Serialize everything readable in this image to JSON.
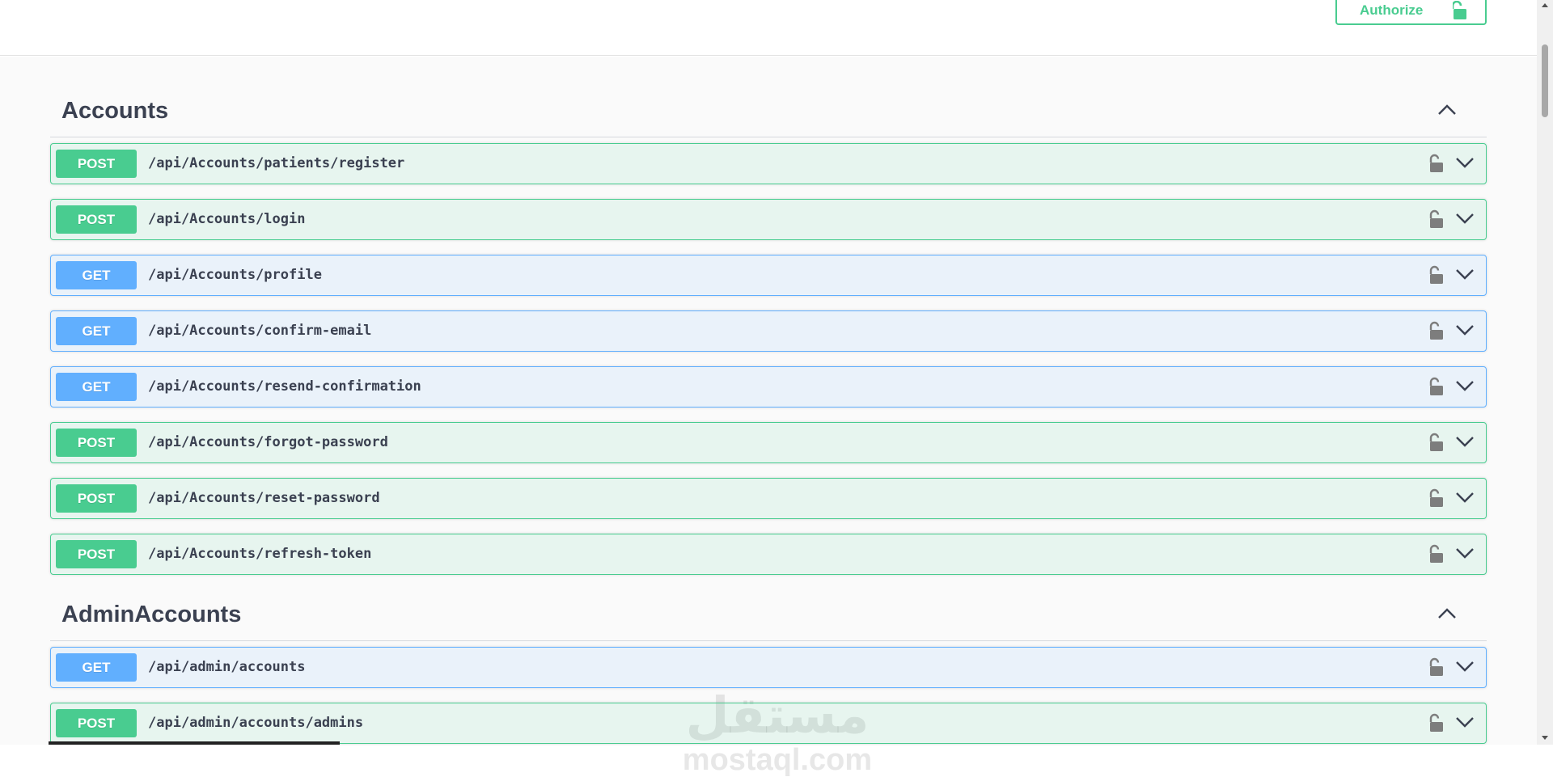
{
  "header": {
    "authorize_label": "Authorize"
  },
  "sections": [
    {
      "title": "Accounts",
      "operations": [
        {
          "method": "POST",
          "path": "/api/Accounts/patients/register"
        },
        {
          "method": "POST",
          "path": "/api/Accounts/login"
        },
        {
          "method": "GET",
          "path": "/api/Accounts/profile"
        },
        {
          "method": "GET",
          "path": "/api/Accounts/confirm-email"
        },
        {
          "method": "GET",
          "path": "/api/Accounts/resend-confirmation"
        },
        {
          "method": "POST",
          "path": "/api/Accounts/forgot-password"
        },
        {
          "method": "POST",
          "path": "/api/Accounts/reset-password"
        },
        {
          "method": "POST",
          "path": "/api/Accounts/refresh-token"
        }
      ]
    },
    {
      "title": "AdminAccounts",
      "operations": [
        {
          "method": "GET",
          "path": "/api/admin/accounts"
        },
        {
          "method": "POST",
          "path": "/api/admin/accounts/admins"
        }
      ]
    }
  ],
  "watermark": {
    "arabic": "مستقل",
    "latin": "mostaql.com"
  },
  "icons": {
    "authorize": "unlocked-lock-icon",
    "operation_lock": "unlocked-lock-icon",
    "operation_expand": "chevron-down-icon",
    "section_collapse": "chevron-up-icon"
  },
  "colors": {
    "post": "#49cc90",
    "get": "#61affe",
    "text": "#3b4151",
    "background": "#fafafa"
  }
}
